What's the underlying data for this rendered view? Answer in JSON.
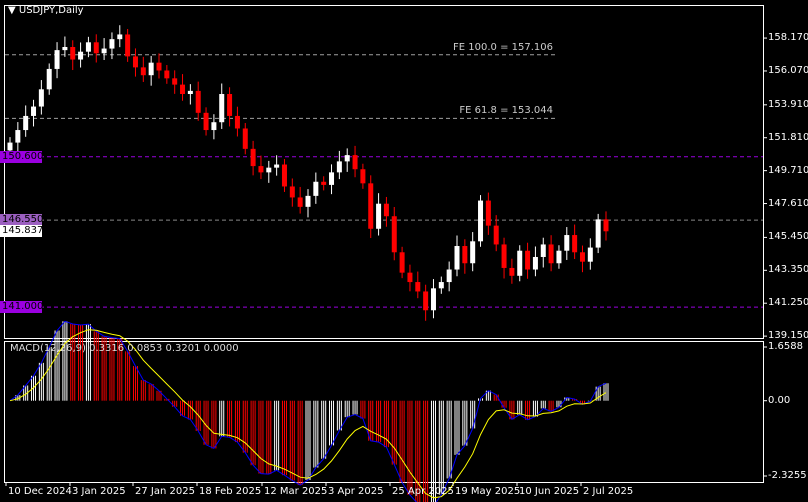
{
  "header": {
    "symbol_title": "USDJPY,Daily"
  },
  "colors": {
    "bull": "#ffffff",
    "bear": "#ff0000",
    "level_purple": "#9a00e0",
    "fe_line": "#a0a0a0",
    "signal": "#ffff00",
    "macd_line": "#0000ff"
  },
  "chart_data": {
    "type": "candlestick",
    "title": "USDJPY,Daily",
    "ylim": [
      139.03,
      160.28
    ],
    "y_ticks": [
      "158.170",
      "156.070",
      "153.910",
      "151.810",
      "149.710",
      "147.610",
      "145.450",
      "143.350",
      "141.250",
      "139.150"
    ],
    "y_tick_values": [
      158.17,
      156.07,
      153.91,
      151.81,
      149.71,
      147.61,
      145.45,
      143.35,
      141.25,
      139.15
    ],
    "x_ticks": [
      "10 Dec 2024",
      "3 Jan 2025",
      "27 Jan 2025",
      "18 Feb 2025",
      "12 Mar 2025",
      "3 Apr 2025",
      "25 Apr 2025",
      "19 May 2025",
      "10 Jun 2025",
      "2 Jul 2025"
    ],
    "start_open": 151.0,
    "closes": [
      151.5,
      152.3,
      153.2,
      153.8,
      154.9,
      156.2,
      157.4,
      157.6,
      156.8,
      157.3,
      157.9,
      157.2,
      157.5,
      158.1,
      158.4,
      157.0,
      156.3,
      155.8,
      156.6,
      156.1,
      155.6,
      155.2,
      154.6,
      154.8,
      153.4,
      152.3,
      152.8,
      154.6,
      153.2,
      152.4,
      151.1,
      150.0,
      149.6,
      149.9,
      150.1,
      148.7,
      148.0,
      147.4,
      148.1,
      149.0,
      148.8,
      149.6,
      150.3,
      150.7,
      149.8,
      148.9,
      146.0,
      147.6,
      146.8,
      144.5,
      143.2,
      142.6,
      142.0,
      140.8,
      142.2,
      142.6,
      143.4,
      144.9,
      143.8,
      145.2,
      147.8,
      146.2,
      145.0,
      143.5,
      143.0,
      144.6,
      143.4,
      144.2,
      145.0,
      143.8,
      144.6,
      145.6,
      144.5,
      143.9,
      144.8,
      146.6,
      145.84
    ],
    "levels": [
      {
        "price": 150.6,
        "label": "150.600",
        "style": "purple"
      },
      {
        "price": 146.55,
        "label": "146.550",
        "style": "gray"
      },
      {
        "price": 141.0,
        "label": "141.000",
        "style": "purple"
      }
    ],
    "fe_levels": [
      {
        "price": 157.106,
        "label": "FE 100.0 = 157.106"
      },
      {
        "price": 153.044,
        "label": "FE 61.8 = 153.044"
      }
    ],
    "current_price": {
      "value": 145.837,
      "label": "145.837"
    },
    "macd": {
      "label": "MACD(12,26,9) 0.3316 0.0853 0.3201 0.0000",
      "ylim": [
        -2.3255,
        1.6588
      ],
      "y_ticks": [
        "1.6588",
        "0.00",
        "-2.3255"
      ],
      "y_tick_values": [
        1.6588,
        0,
        -2.3255
      ]
    }
  }
}
